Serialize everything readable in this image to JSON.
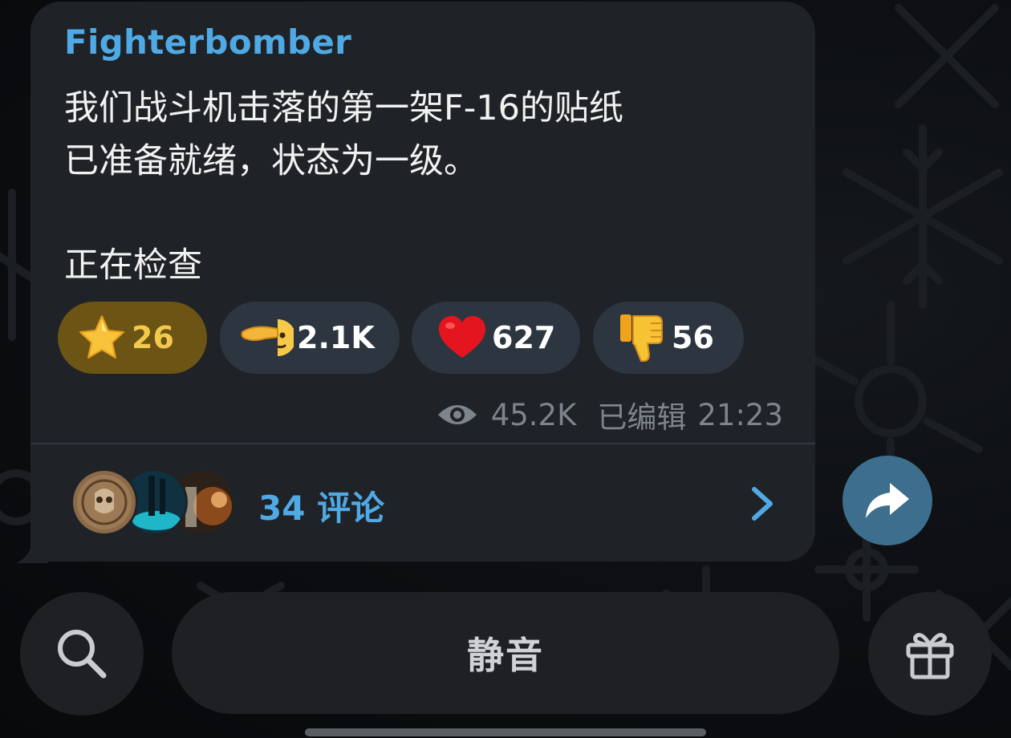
{
  "message": {
    "sender": "Fighterbomber",
    "lines": [
      "我们战斗机击落的第一架F-16的贴纸",
      "已准备就绪，状态为一级。",
      "正在检查"
    ]
  },
  "reactions": [
    {
      "icon": "star-icon",
      "count": "26"
    },
    {
      "icon": "saluting-face-emoji",
      "count": "2.1K"
    },
    {
      "icon": "red-heart-emoji",
      "count": "627"
    },
    {
      "icon": "thumbs-down-emoji",
      "count": "56"
    }
  ],
  "meta": {
    "views": "45.2K",
    "edited_label": "已编辑",
    "time": "21:23"
  },
  "comments": {
    "label": "34 评论"
  },
  "bottom_bar": {
    "mute_label": "静音"
  },
  "colors": {
    "accent": "#4fa9e4",
    "bubble": "#1f2226",
    "share_button": "#3e6e8e",
    "star_reaction_bg": "#6b5414"
  }
}
